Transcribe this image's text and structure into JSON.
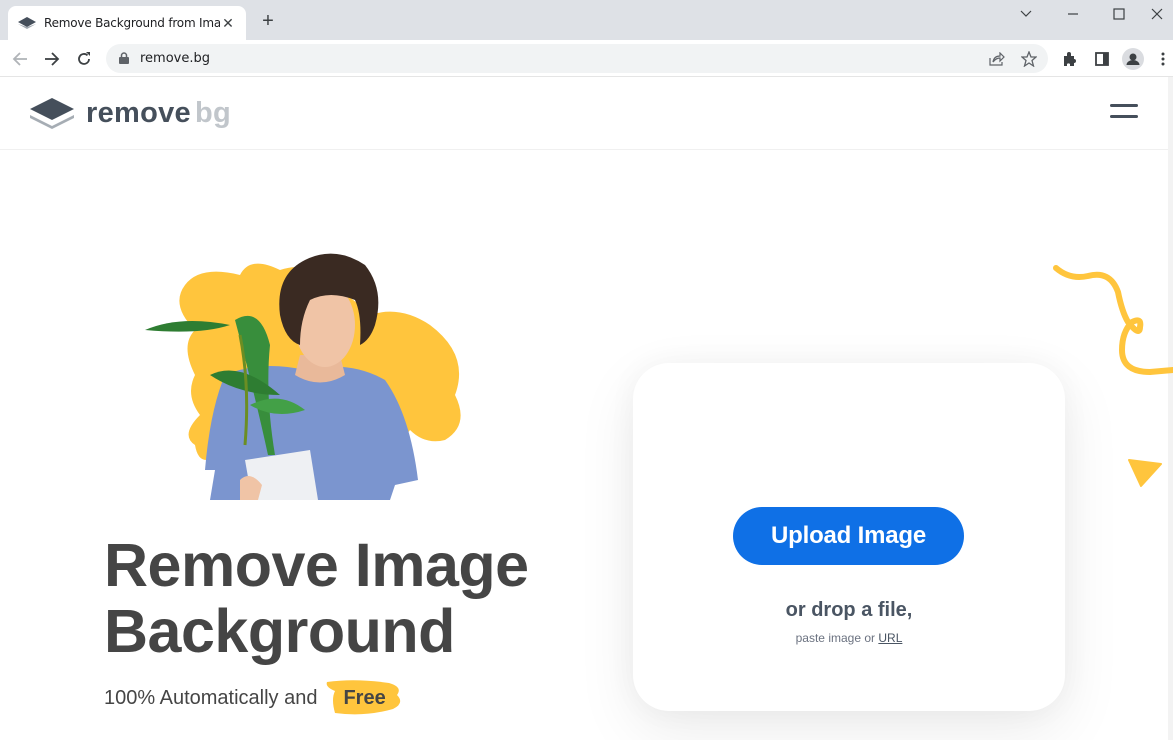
{
  "browser": {
    "tab_title": "Remove Background from Image",
    "tab_close": "✕",
    "new_tab": "+",
    "url": "remove.bg",
    "window_controls": [
      "tab-search",
      "minimize",
      "maximize",
      "close"
    ]
  },
  "site": {
    "logo_word1": "remove",
    "logo_word2": "bg",
    "menu_icon": "hamburger-icon"
  },
  "hero": {
    "headline_line1": "Remove Image",
    "headline_line2": "Background",
    "subline": "100% Automatically and",
    "free_badge": "Free"
  },
  "upload": {
    "button_label": "Upload Image",
    "drop_text": "or drop a file,",
    "paste_prefix": "paste image or",
    "url_link": "URL"
  },
  "colors": {
    "accent_blue": "#0f70e6",
    "brand_yellow": "#ffc53d",
    "text_dark": "#454545",
    "logo_gray": "#454f5b"
  }
}
